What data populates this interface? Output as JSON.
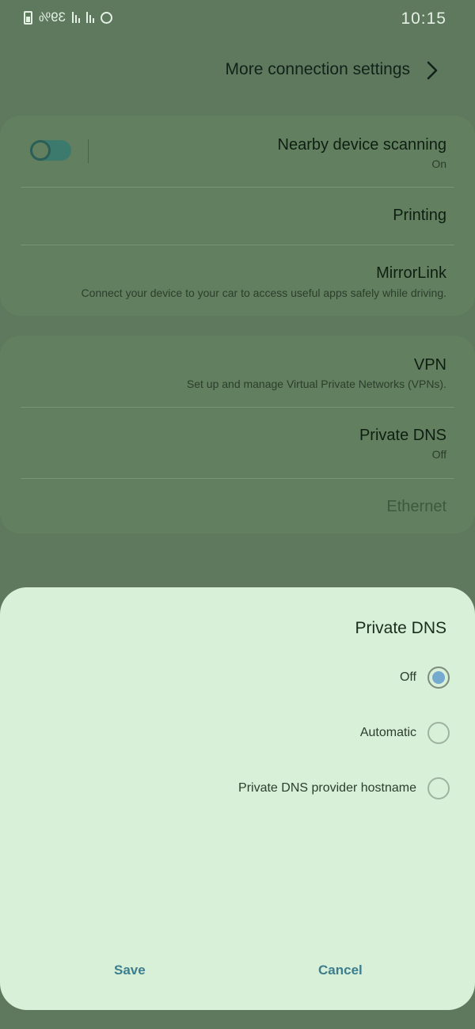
{
  "status_bar": {
    "time": "10:15",
    "battery": "39%"
  },
  "header": {
    "title": "More connection settings",
    "icon": "back-chevron"
  },
  "settings": {
    "group1": [
      {
        "title": "Nearby device scanning",
        "subtitle": "On",
        "toggle": true
      },
      {
        "title": "Printing",
        "subtitle": ""
      },
      {
        "title": "MirrorLink",
        "subtitle": "Connect your device to your car to access useful apps safely while driving."
      }
    ],
    "group2": [
      {
        "title": "VPN",
        "subtitle": "Set up and manage Virtual Private Networks (VPNs)."
      },
      {
        "title": "Private DNS",
        "subtitle": "Off"
      },
      {
        "title": "Ethernet",
        "subtitle": ""
      }
    ]
  },
  "dialog": {
    "title": "Private DNS",
    "options": [
      "Off",
      "Automatic",
      "Private DNS provider hostname"
    ],
    "selected": "Off",
    "cancel_label": "Cancel",
    "save_label": "Save"
  },
  "colors": {
    "accent": "#3c7d8e",
    "radio_selected": "#75aad0"
  }
}
